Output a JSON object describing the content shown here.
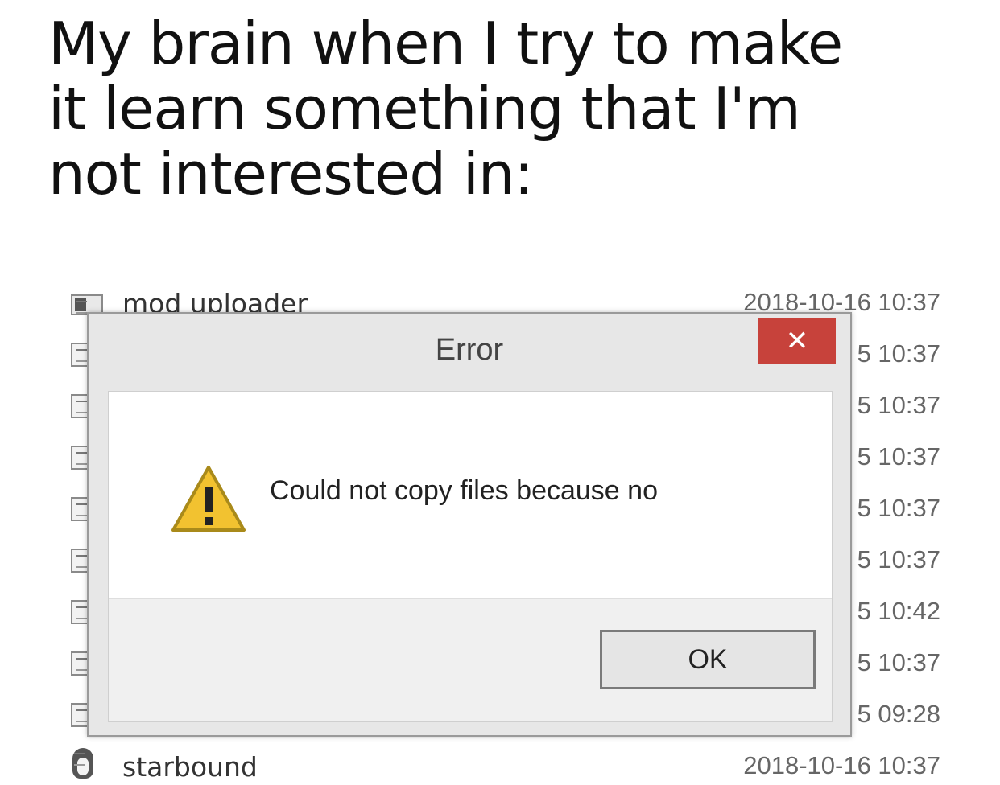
{
  "caption": {
    "line1": "My brain when I try to make",
    "line2": "it learn something that I'm",
    "line3": "not interested in:"
  },
  "files": [
    {
      "name": "mod uploader",
      "date": "2018-10-16 10:37",
      "icon": "window-icon"
    },
    {
      "name": "",
      "date": "5 10:37",
      "icon": "file-icon"
    },
    {
      "name": "",
      "date": "5 10:37",
      "icon": "file-icon"
    },
    {
      "name": "",
      "date": "5 10:37",
      "icon": "file-icon"
    },
    {
      "name": "",
      "date": "5 10:37",
      "icon": "file-icon"
    },
    {
      "name": "",
      "date": "5 10:37",
      "icon": "file-icon"
    },
    {
      "name": "",
      "date": "5 10:42",
      "icon": "file-icon"
    },
    {
      "name": "",
      "date": "5 10:37",
      "icon": "file-icon"
    },
    {
      "name": "",
      "date": "5 09:28",
      "icon": "exe-icon"
    },
    {
      "name": "starbound",
      "date": "2018-10-16 10:37",
      "icon": "penguin-icon"
    }
  ],
  "dialog": {
    "title": "Error",
    "close_glyph": "✕",
    "message": "Could not copy files because no",
    "ok_label": "OK",
    "icon": "warning-icon"
  },
  "colors": {
    "close_button": "#c7423b",
    "warning_fill": "#f2c230",
    "dialog_frame": "#e7e7e7"
  }
}
